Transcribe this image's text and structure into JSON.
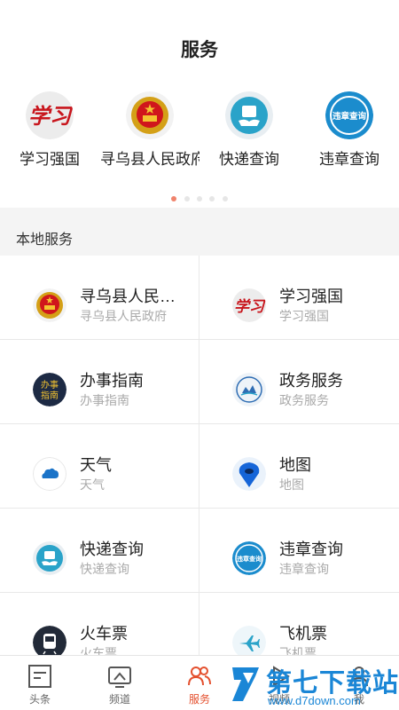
{
  "header": {
    "title": "服务"
  },
  "top_services": [
    {
      "label": "学习强国",
      "icon": "xuexi-qiangguo-icon"
    },
    {
      "label": "寻乌县人民政府",
      "icon": "national-emblem-icon"
    },
    {
      "label": "快递查询",
      "icon": "express-query-icon"
    },
    {
      "label": "违章查询",
      "icon": "violation-query-icon",
      "icon_text": "违章查询"
    }
  ],
  "pager": {
    "count": 5,
    "active": 0
  },
  "section": {
    "title": "本地服务"
  },
  "local_services": [
    {
      "title": "寻乌县人民…",
      "subtitle": "寻乌县人民政府",
      "icon": "national-emblem-icon"
    },
    {
      "title": "学习强国",
      "subtitle": "学习强国",
      "icon": "xuexi-qiangguo-icon"
    },
    {
      "title": "办事指南",
      "subtitle": "办事指南",
      "icon": "guide-icon",
      "icon_text": [
        "办事",
        "指南"
      ]
    },
    {
      "title": "政务服务",
      "subtitle": "政务服务",
      "icon": "gov-service-icon"
    },
    {
      "title": "天气",
      "subtitle": "天气",
      "icon": "weather-cloud-icon"
    },
    {
      "title": "地图",
      "subtitle": "地图",
      "icon": "map-pin-icon"
    },
    {
      "title": "快递查询",
      "subtitle": "快递查询",
      "icon": "express-query-icon"
    },
    {
      "title": "违章查询",
      "subtitle": "违章查询",
      "icon": "violation-query-icon",
      "icon_text": "违章查询"
    },
    {
      "title": "火车票",
      "subtitle": "火车票",
      "icon": "train-icon"
    },
    {
      "title": "飞机票",
      "subtitle": "飞机票",
      "icon": "airplane-icon"
    }
  ],
  "tabbar": [
    {
      "label": "头条",
      "icon": "headline-icon"
    },
    {
      "label": "频道",
      "icon": "channel-icon"
    },
    {
      "label": "服务",
      "icon": "service-people-icon",
      "active": true
    },
    {
      "label": "视频",
      "icon": "video-play-icon"
    },
    {
      "label": "我",
      "icon": "me-user-icon"
    }
  ],
  "watermark": {
    "text": "第七下载站",
    "url": "www.d7down.com"
  },
  "colors": {
    "accent": "#e4502e",
    "brand_blue": "#1a86d6",
    "section_bg": "#f4f4f4"
  }
}
